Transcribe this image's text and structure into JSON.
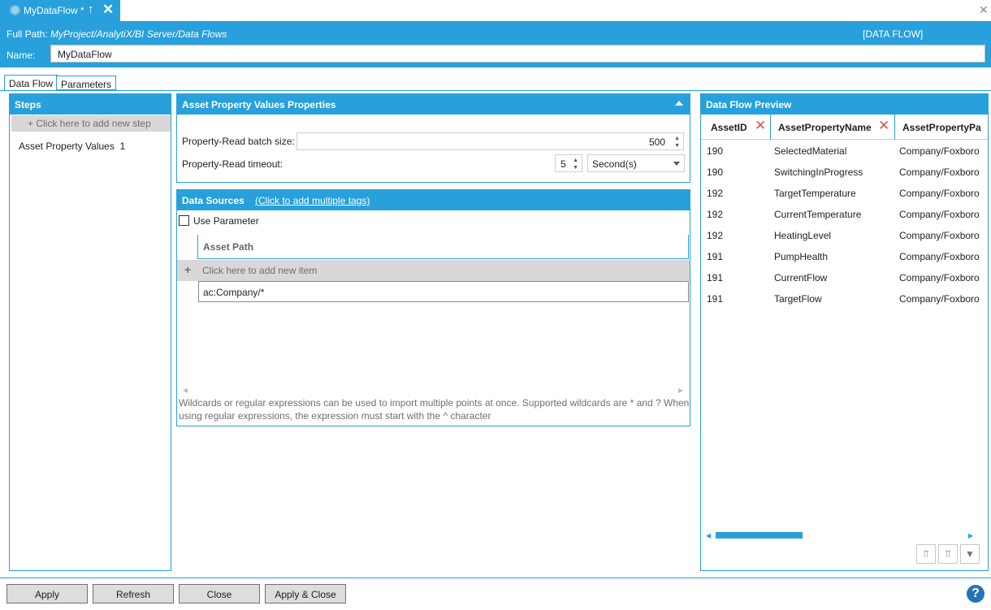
{
  "tab": {
    "title": "MyDataFlow *",
    "pin_icon": "↑",
    "close_icon": "✕"
  },
  "window": {
    "close_icon": "✕"
  },
  "header": {
    "path_label": "Full Path:",
    "path_value": "MyProject/AnalytiX/BI Server/Data Flows",
    "type": "[DATA FLOW]",
    "name_label": "Name:",
    "name_value": "MyDataFlow"
  },
  "subtabs": [
    "Data Flow",
    "Parameters"
  ],
  "steps": {
    "title": "Steps",
    "add_label": "+ Click here to add new step",
    "items": [
      {
        "label": "Asset Property Values",
        "count": "1"
      }
    ]
  },
  "properties": {
    "title": "Asset Property Values Properties",
    "batch_label": "Property-Read batch size:",
    "batch_value": "500",
    "timeout_label": "Property-Read timeout:",
    "timeout_value": "5",
    "timeout_unit": "Second(s)"
  },
  "sources": {
    "title": "Data Sources",
    "link": "(Click to add multiple tags)",
    "use_param_label": "Use Parameter",
    "column": "Asset Path",
    "add_item": "Click here to add new item",
    "rows": [
      "ac:Company/*"
    ],
    "note": "Wildcards or regular expressions can be used to import multiple points at once. Supported wildcards are * and ? When using regular expressions, the expression must start with the ^ character"
  },
  "preview": {
    "title": "Data Flow Preview",
    "columns": [
      "AssetID",
      "AssetPropertyName",
      "AssetPropertyPa"
    ],
    "rows": [
      [
        "190",
        "SelectedMaterial",
        "Company/Foxboro"
      ],
      [
        "190",
        "SwitchingInProgress",
        "Company/Foxboro"
      ],
      [
        "192",
        "TargetTemperature",
        "Company/Foxboro"
      ],
      [
        "192",
        "CurrentTemperature",
        "Company/Foxboro"
      ],
      [
        "192",
        "HeatingLevel",
        "Company/Foxboro"
      ],
      [
        "191",
        "PumpHealth",
        "Company/Foxboro"
      ],
      [
        "191",
        "CurrentFlow",
        "Company/Foxboro"
      ],
      [
        "191",
        "TargetFlow",
        "Company/Foxboro"
      ]
    ]
  },
  "footer": {
    "apply": "Apply",
    "refresh": "Refresh",
    "close": "Close",
    "apply_close": "Apply & Close",
    "help": "?"
  }
}
